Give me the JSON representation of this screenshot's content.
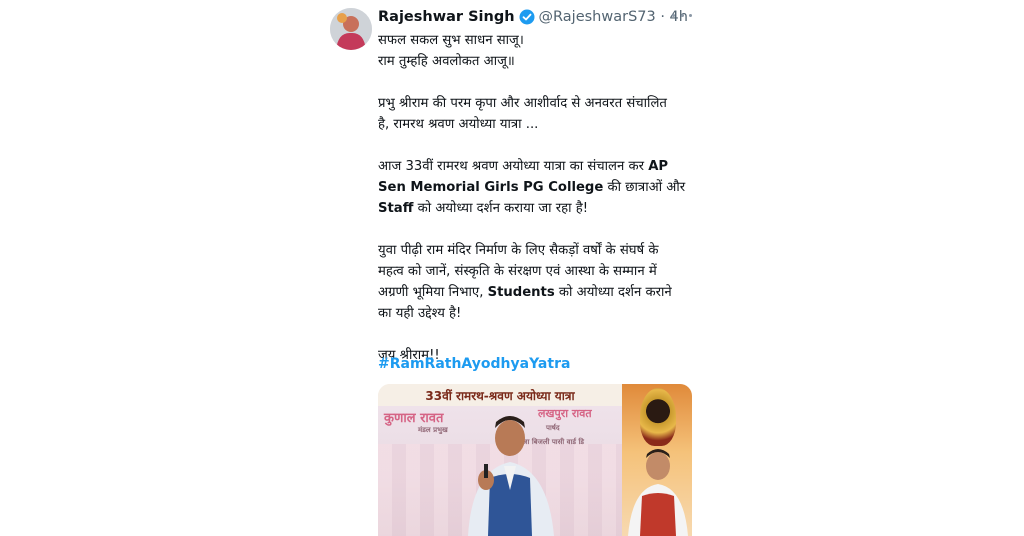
{
  "tweet": {
    "author_name": "Rajeshwar Singh",
    "handle_time": "@RajeshwarS73 · 4h",
    "lines": {
      "l1": "सफल सकल सुभ साधन साजू।",
      "l2": "राम तुम्हहि अवलोकत आजू॥",
      "l3": "प्रभु श्रीराम की परम कृपा और आशीर्वाद से अनवरत संचालित",
      "l4": "है, रामरथ श्रवण अयोध्या यात्रा ...",
      "l5a": "आज 33वीं रामरथ श्रवण अयोध्या यात्रा का संचालन कर ",
      "l5b": "AP",
      "l6a": "Sen Memorial Girls PG College",
      "l6b": " की छात्राओं और",
      "l7a": "Staff",
      "l7b": " को अयोध्या दर्शन कराया जा रहा है!",
      "l8": "युवा पीढ़ी राम मंदिर निर्माण के लिए सैकड़ों वर्षों के संघर्ष के",
      "l9": "महत्व को जानें, संस्कृति के संरक्षण एवं आस्था के सम्मान में",
      "l10a": "अग्रणी भूमिया निभाए, ",
      "l10b": "Students",
      "l10c": " को अयोध्या दर्शन कराने",
      "l11": "का यही उद्देश्य है!",
      "l12": "जय श्रीराम!!"
    },
    "hashtag": "#RamRathAyodhyaYatra",
    "media": {
      "banner": "33वीं रामरथ-श्रवण अयोध्या यात्रा",
      "backdrop_texts": [
        "कुणाल रावत",
        "लखपुरा रावत",
        "मंडल प्रभुख",
        "पार्षद",
        "महाराजा बिजली पासी वार्ड डि"
      ]
    }
  },
  "colors": {
    "link": "#1d9bf0",
    "verified": "#1d9bf0",
    "secondary_text": "#536471"
  }
}
